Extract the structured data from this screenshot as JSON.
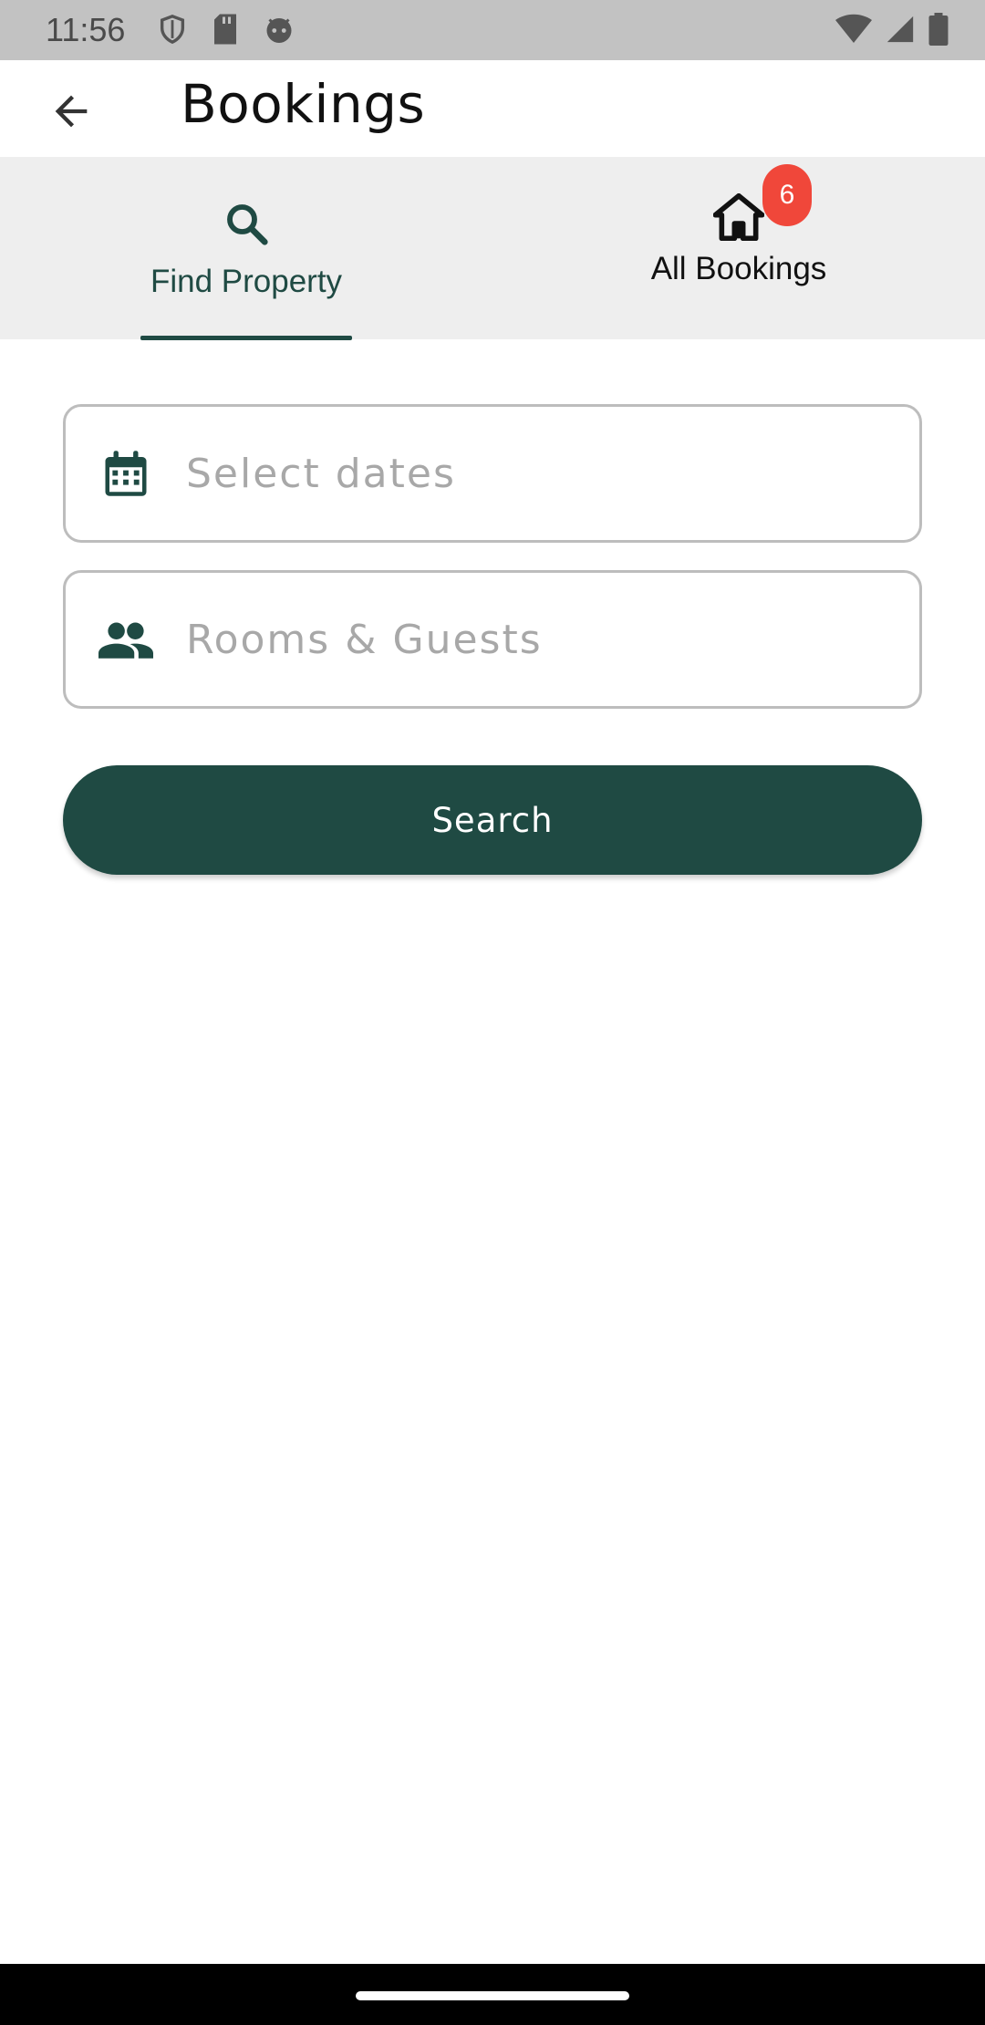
{
  "status_bar": {
    "time": "11:56",
    "icons_left": [
      "shield-icon",
      "sd-card-icon",
      "android-face-icon"
    ],
    "icons_right": [
      "wifi-icon",
      "signal-icon",
      "battery-icon"
    ]
  },
  "app_bar": {
    "title": "Bookings",
    "back_icon": "arrow-back-icon"
  },
  "tabs": [
    {
      "label": "Find Property",
      "icon": "search-icon",
      "selected": true
    },
    {
      "label": "All Bookings",
      "icon": "home-icon",
      "selected": false,
      "badge": "6"
    }
  ],
  "form": {
    "dates_placeholder": "Select dates",
    "dates_icon": "calendar-icon",
    "guests_placeholder": "Rooms & Guests",
    "guests_icon": "people-icon",
    "search_label": "Search"
  },
  "colors": {
    "primary": "#1f4a43",
    "badge": "#f0473a",
    "tab_background": "#eeeeee",
    "status_bar": "#c2c2c2"
  }
}
